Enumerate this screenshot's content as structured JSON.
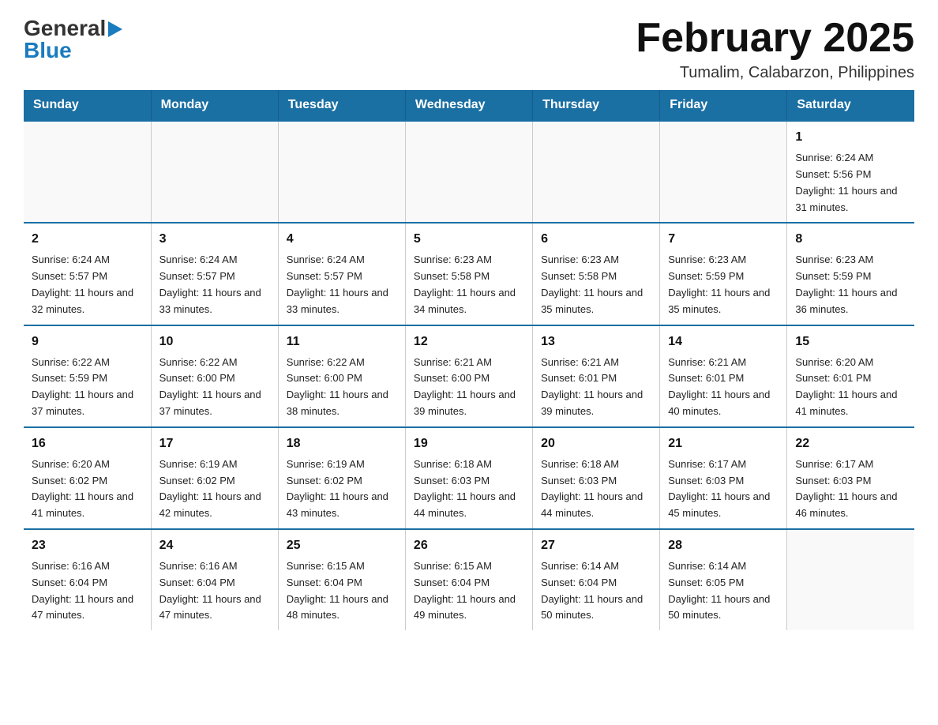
{
  "header": {
    "logo": {
      "general": "General",
      "flag_shape": "triangle",
      "blue": "Blue"
    },
    "title": "February 2025",
    "subtitle": "Tumalim, Calabarzon, Philippines"
  },
  "days_of_week": [
    "Sunday",
    "Monday",
    "Tuesday",
    "Wednesday",
    "Thursday",
    "Friday",
    "Saturday"
  ],
  "weeks": [
    {
      "days": [
        {
          "number": "",
          "info": ""
        },
        {
          "number": "",
          "info": ""
        },
        {
          "number": "",
          "info": ""
        },
        {
          "number": "",
          "info": ""
        },
        {
          "number": "",
          "info": ""
        },
        {
          "number": "",
          "info": ""
        },
        {
          "number": "1",
          "info": "Sunrise: 6:24 AM\nSunset: 5:56 PM\nDaylight: 11 hours and 31 minutes."
        }
      ]
    },
    {
      "days": [
        {
          "number": "2",
          "info": "Sunrise: 6:24 AM\nSunset: 5:57 PM\nDaylight: 11 hours and 32 minutes."
        },
        {
          "number": "3",
          "info": "Sunrise: 6:24 AM\nSunset: 5:57 PM\nDaylight: 11 hours and 33 minutes."
        },
        {
          "number": "4",
          "info": "Sunrise: 6:24 AM\nSunset: 5:57 PM\nDaylight: 11 hours and 33 minutes."
        },
        {
          "number": "5",
          "info": "Sunrise: 6:23 AM\nSunset: 5:58 PM\nDaylight: 11 hours and 34 minutes."
        },
        {
          "number": "6",
          "info": "Sunrise: 6:23 AM\nSunset: 5:58 PM\nDaylight: 11 hours and 35 minutes."
        },
        {
          "number": "7",
          "info": "Sunrise: 6:23 AM\nSunset: 5:59 PM\nDaylight: 11 hours and 35 minutes."
        },
        {
          "number": "8",
          "info": "Sunrise: 6:23 AM\nSunset: 5:59 PM\nDaylight: 11 hours and 36 minutes."
        }
      ]
    },
    {
      "days": [
        {
          "number": "9",
          "info": "Sunrise: 6:22 AM\nSunset: 5:59 PM\nDaylight: 11 hours and 37 minutes."
        },
        {
          "number": "10",
          "info": "Sunrise: 6:22 AM\nSunset: 6:00 PM\nDaylight: 11 hours and 37 minutes."
        },
        {
          "number": "11",
          "info": "Sunrise: 6:22 AM\nSunset: 6:00 PM\nDaylight: 11 hours and 38 minutes."
        },
        {
          "number": "12",
          "info": "Sunrise: 6:21 AM\nSunset: 6:00 PM\nDaylight: 11 hours and 39 minutes."
        },
        {
          "number": "13",
          "info": "Sunrise: 6:21 AM\nSunset: 6:01 PM\nDaylight: 11 hours and 39 minutes."
        },
        {
          "number": "14",
          "info": "Sunrise: 6:21 AM\nSunset: 6:01 PM\nDaylight: 11 hours and 40 minutes."
        },
        {
          "number": "15",
          "info": "Sunrise: 6:20 AM\nSunset: 6:01 PM\nDaylight: 11 hours and 41 minutes."
        }
      ]
    },
    {
      "days": [
        {
          "number": "16",
          "info": "Sunrise: 6:20 AM\nSunset: 6:02 PM\nDaylight: 11 hours and 41 minutes."
        },
        {
          "number": "17",
          "info": "Sunrise: 6:19 AM\nSunset: 6:02 PM\nDaylight: 11 hours and 42 minutes."
        },
        {
          "number": "18",
          "info": "Sunrise: 6:19 AM\nSunset: 6:02 PM\nDaylight: 11 hours and 43 minutes."
        },
        {
          "number": "19",
          "info": "Sunrise: 6:18 AM\nSunset: 6:03 PM\nDaylight: 11 hours and 44 minutes."
        },
        {
          "number": "20",
          "info": "Sunrise: 6:18 AM\nSunset: 6:03 PM\nDaylight: 11 hours and 44 minutes."
        },
        {
          "number": "21",
          "info": "Sunrise: 6:17 AM\nSunset: 6:03 PM\nDaylight: 11 hours and 45 minutes."
        },
        {
          "number": "22",
          "info": "Sunrise: 6:17 AM\nSunset: 6:03 PM\nDaylight: 11 hours and 46 minutes."
        }
      ]
    },
    {
      "days": [
        {
          "number": "23",
          "info": "Sunrise: 6:16 AM\nSunset: 6:04 PM\nDaylight: 11 hours and 47 minutes."
        },
        {
          "number": "24",
          "info": "Sunrise: 6:16 AM\nSunset: 6:04 PM\nDaylight: 11 hours and 47 minutes."
        },
        {
          "number": "25",
          "info": "Sunrise: 6:15 AM\nSunset: 6:04 PM\nDaylight: 11 hours and 48 minutes."
        },
        {
          "number": "26",
          "info": "Sunrise: 6:15 AM\nSunset: 6:04 PM\nDaylight: 11 hours and 49 minutes."
        },
        {
          "number": "27",
          "info": "Sunrise: 6:14 AM\nSunset: 6:04 PM\nDaylight: 11 hours and 50 minutes."
        },
        {
          "number": "28",
          "info": "Sunrise: 6:14 AM\nSunset: 6:05 PM\nDaylight: 11 hours and 50 minutes."
        },
        {
          "number": "",
          "info": ""
        }
      ]
    }
  ]
}
